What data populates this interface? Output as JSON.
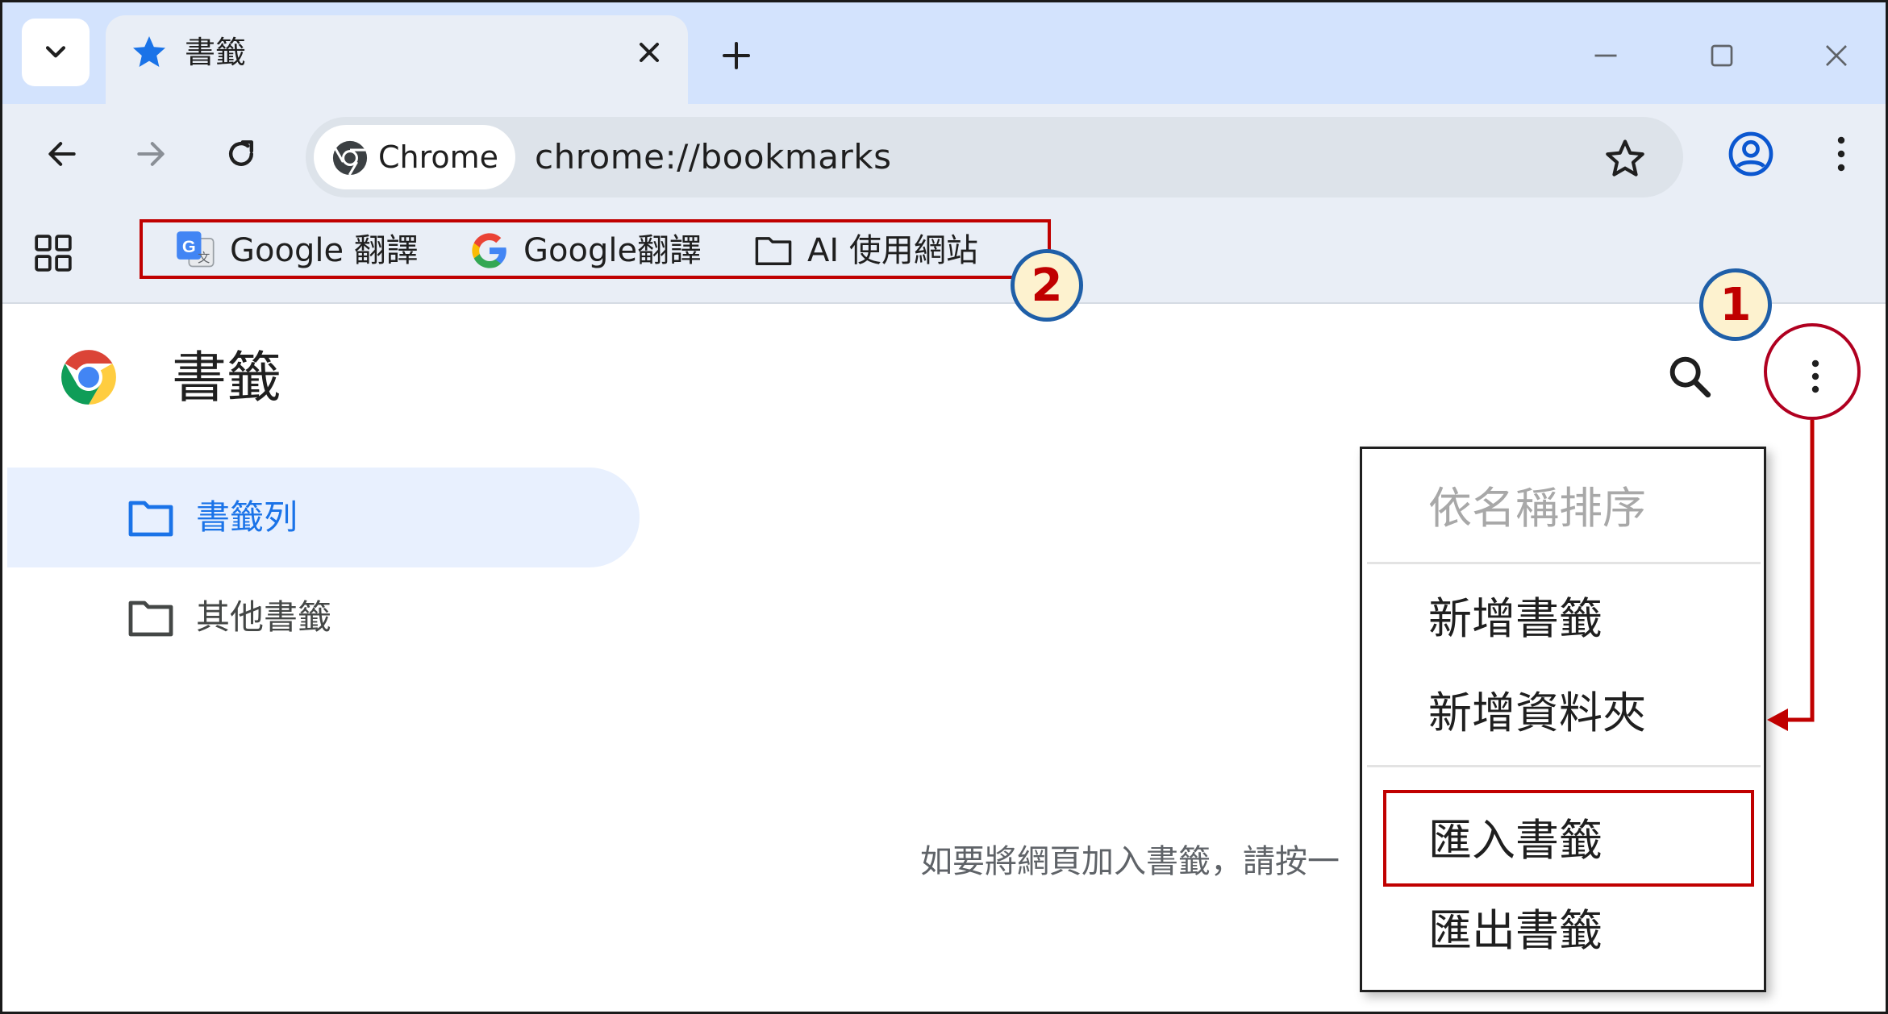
{
  "tab": {
    "title": "書籤"
  },
  "omnibox": {
    "chip_label": "Chrome",
    "url": "chrome://bookmarks"
  },
  "bookmarks_bar": {
    "items": [
      {
        "label": "Google 翻譯",
        "icon": "google-translate-icon"
      },
      {
        "label": "Google翻譯",
        "icon": "google-g-icon"
      },
      {
        "label": "AI 使用網站",
        "icon": "folder-icon"
      }
    ]
  },
  "page": {
    "title": "書籤"
  },
  "sidebar": {
    "items": [
      {
        "label": "書籤列",
        "active": true
      },
      {
        "label": "其他書籤",
        "active": false
      }
    ]
  },
  "empty_message": "如要將網頁加入書籤，請按一",
  "menu": {
    "items": {
      "sort": "依名稱排序",
      "add_bookmark": "新增書籤",
      "add_folder": "新增資料夾",
      "import": "匯入書籤",
      "export": "匯出書籤"
    }
  },
  "annotations": {
    "badge1": "1",
    "badge2": "2"
  },
  "colors": {
    "accent_blue": "#1a73e8",
    "annotation_red": "#c00000",
    "badge_fill": "#fdf2cf",
    "badge_border": "#1f5fa8"
  }
}
